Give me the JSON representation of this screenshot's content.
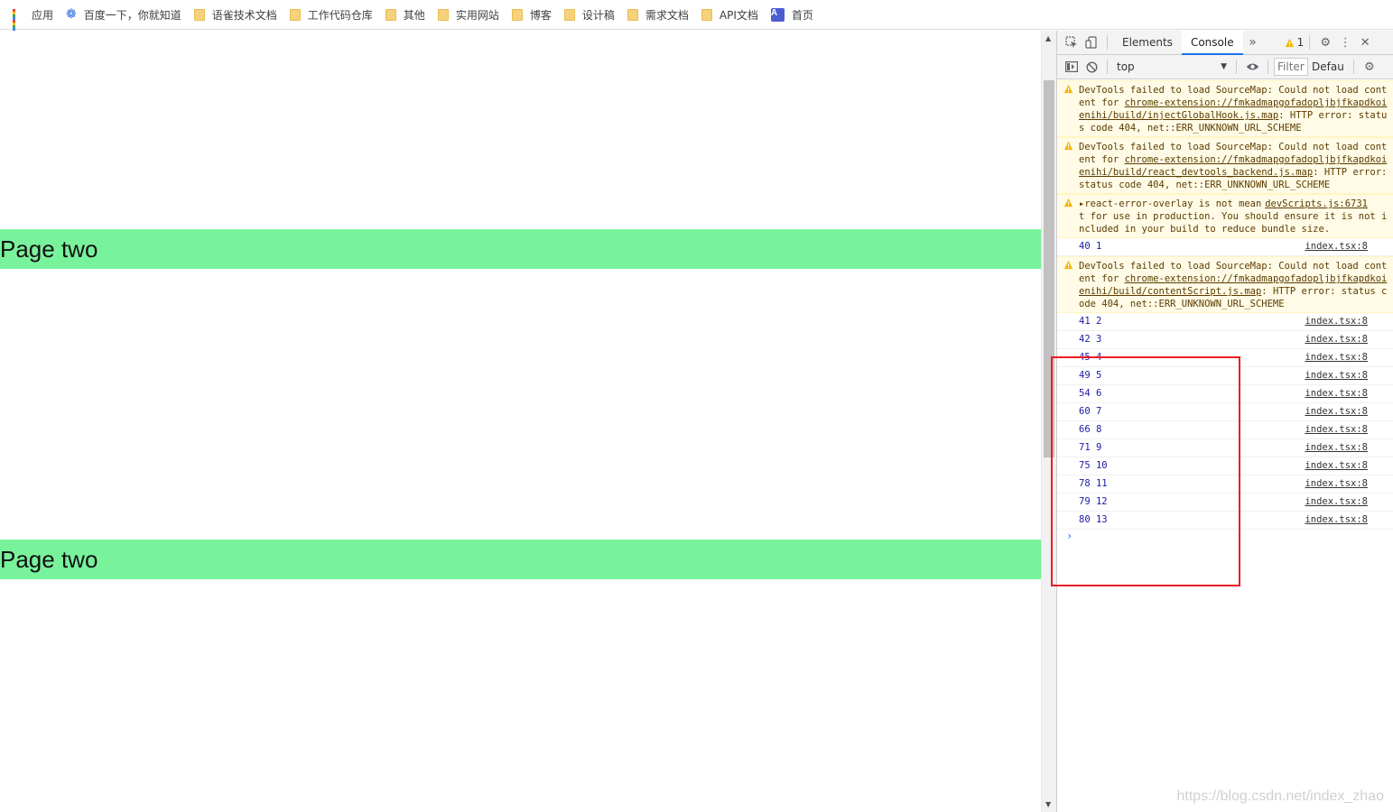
{
  "bookmarks": [
    {
      "label": "应用",
      "icon": "apps-grid-icon"
    },
    {
      "label": "百度一下，你就知道",
      "icon": "baidu-paw-icon"
    },
    {
      "label": "语雀技术文档",
      "icon": "folder-icon"
    },
    {
      "label": "工作代码仓库",
      "icon": "folder-icon"
    },
    {
      "label": "其他",
      "icon": "folder-icon"
    },
    {
      "label": "实用网站",
      "icon": "folder-icon"
    },
    {
      "label": "博客",
      "icon": "folder-icon"
    },
    {
      "label": "设计稿",
      "icon": "folder-icon"
    },
    {
      "label": "需求文档",
      "icon": "folder-icon"
    },
    {
      "label": "API文档",
      "icon": "folder-icon"
    },
    {
      "label": "首页",
      "icon": "a-app-icon"
    }
  ],
  "page": {
    "banners": [
      "Page two",
      "Page two"
    ],
    "banner_color": "#79f29c"
  },
  "devtools": {
    "tabs": {
      "elements": "Elements",
      "console": "Console",
      "more": "»"
    },
    "warning_count": "1",
    "context": "top",
    "filter_placeholder": "Filter",
    "levels": "Defau",
    "warn_color": "#fffbe6"
  },
  "console": {
    "w1": {
      "pre": "DevTools failed to load SourceMap: Could not load content for ",
      "link": "chrome-extension://fmkadmapgofadopljbjfkapdkoienihi/build/injectGlobalHook.js.map",
      "post": ": HTTP error: status code 404, net::ERR_UNKNOWN_URL_SCHEME"
    },
    "w2": {
      "pre": "DevTools failed to load SourceMap: Could not load content for ",
      "link": "chrome-extension://fmkadmapgofadopljbjfkapdkoienihi/build/react_devtools_backend.js.map",
      "post": ": HTTP error: status code 404, net::ERR_UNKNOWN_URL_SCHEME"
    },
    "w3": {
      "source": "devScripts.js:6731",
      "text": "▸react-error-overlay is not meant for use in production. You should ensure it is not included in your build to reduce bundle size."
    },
    "first_log": {
      "text": "40 1",
      "source": "index.tsx:8"
    },
    "w4": {
      "pre": "DevTools failed to load SourceMap: Could not load content for ",
      "link": "chrome-extension://fmkadmapgofadopljbjfkapdkoienihi/build/contentScript.js.map",
      "post": ": HTTP error: status code 404, net::ERR_UNKNOWN_URL_SCHEME"
    },
    "logs": [
      {
        "text": "41 2",
        "source": "index.tsx:8"
      },
      {
        "text": "42 3",
        "source": "index.tsx:8"
      },
      {
        "text": "45 4",
        "source": "index.tsx:8"
      },
      {
        "text": "49 5",
        "source": "index.tsx:8"
      },
      {
        "text": "54 6",
        "source": "index.tsx:8"
      },
      {
        "text": "60 7",
        "source": "index.tsx:8"
      },
      {
        "text": "66 8",
        "source": "index.tsx:8"
      },
      {
        "text": "71 9",
        "source": "index.tsx:8"
      },
      {
        "text": "75 10",
        "source": "index.tsx:8"
      },
      {
        "text": "78 11",
        "source": "index.tsx:8"
      },
      {
        "text": "79 12",
        "source": "index.tsx:8"
      },
      {
        "text": "80 13",
        "source": "index.tsx:8"
      }
    ],
    "prompt": "›"
  },
  "highlight_color": "#ec1c24",
  "watermark": "https://blog.csdn.net/index_zhao"
}
